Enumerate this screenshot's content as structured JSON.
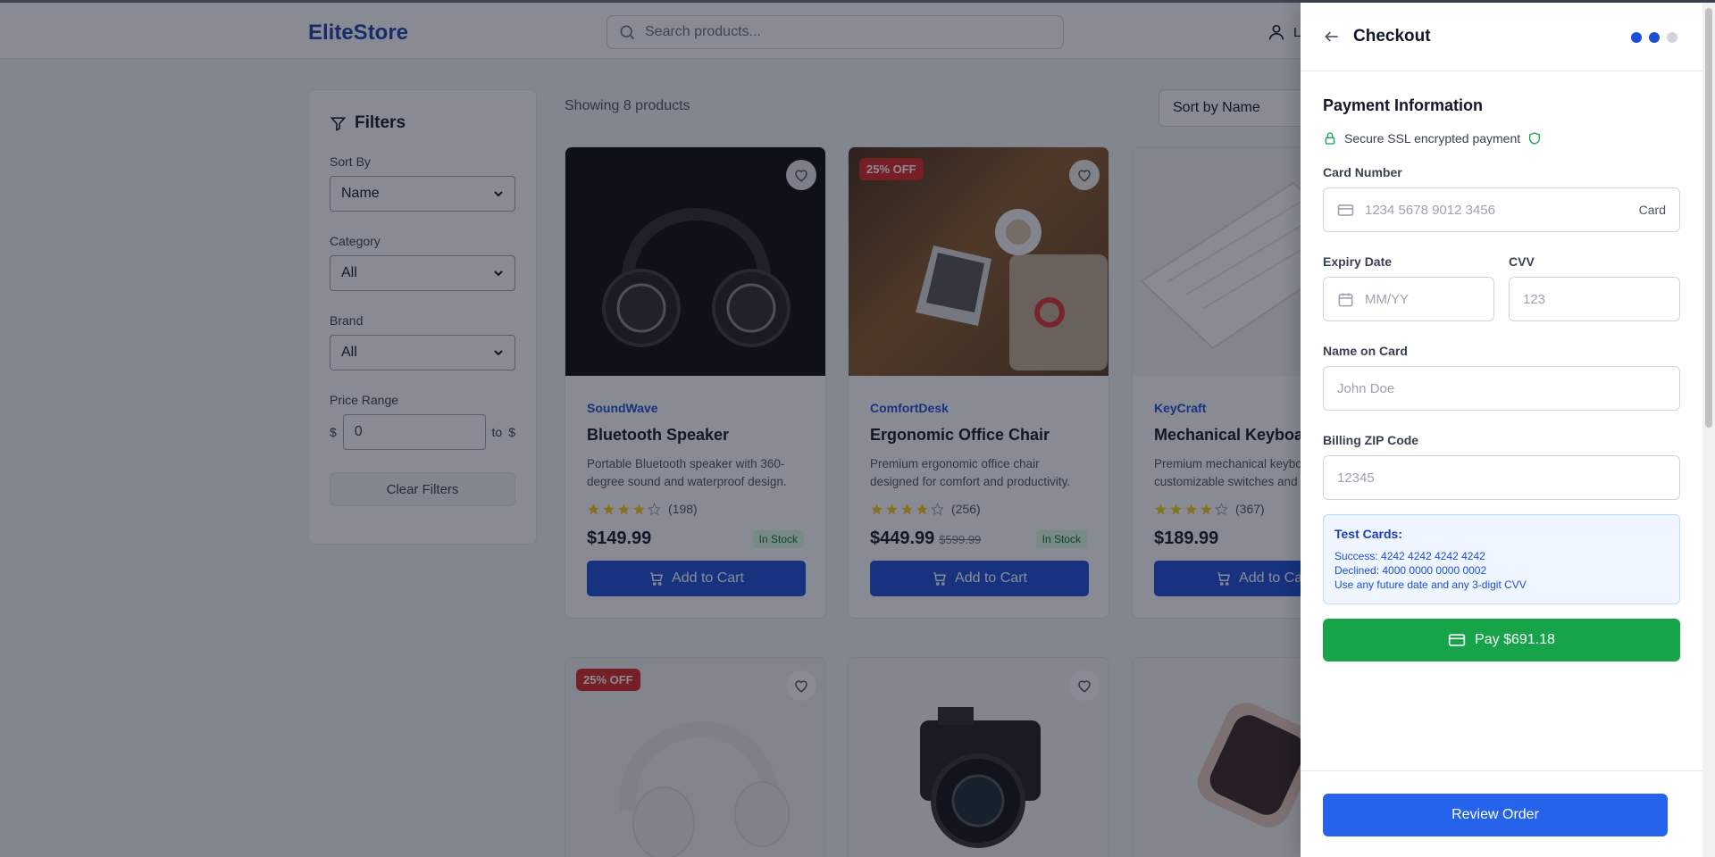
{
  "header": {
    "logo": "EliteStore",
    "search_placeholder": "Search products...",
    "user_label": "L"
  },
  "filters": {
    "title": "Filters",
    "sort_label": "Sort By",
    "sort_value": "Name",
    "category_label": "Category",
    "category_value": "All",
    "brand_label": "Brand",
    "brand_value": "All",
    "price_label": "Price Range",
    "currency": "$",
    "price_min": "0",
    "to_label": "to",
    "currency2": "$",
    "clear_label": "Clear Filters"
  },
  "main": {
    "showing": "Showing 8 products",
    "sort_select": "Sort by Name"
  },
  "products": [
    {
      "brand": "SoundWave",
      "name": "Bluetooth Speaker",
      "desc": "Portable Bluetooth speaker with 360-degree sound and waterproof design.",
      "rating": 4,
      "reviews": "(198)",
      "price": "$149.99",
      "old_price": "",
      "stock": "In Stock",
      "badge": "",
      "add_label": "Add to Cart"
    },
    {
      "brand": "ComfortDesk",
      "name": "Ergonomic Office Chair",
      "desc": "Premium ergonomic office chair designed for comfort and productivity.",
      "rating": 4,
      "reviews": "(256)",
      "price": "$449.99",
      "old_price": "$599.99",
      "stock": "In Stock",
      "badge": "25% OFF",
      "add_label": "Add to Cart"
    },
    {
      "brand": "KeyCraft",
      "name": "Mechanical Keyboard",
      "desc": "Premium mechanical keyboard with customizable switches and RGB.",
      "rating": 4,
      "reviews": "(367)",
      "price": "$189.99",
      "old_price": "",
      "stock": "",
      "badge": "",
      "add_label": "Add to Cart"
    },
    {
      "badge": "25% OFF"
    }
  ],
  "checkout": {
    "title": "Checkout",
    "section_title": "Payment Information",
    "secure_text": "Secure SSL encrypted payment",
    "card_number_label": "Card Number",
    "card_number_placeholder": "1234 5678 9012 3456",
    "card_tag": "Card",
    "expiry_label": "Expiry Date",
    "expiry_placeholder": "MM/YY",
    "cvv_label": "CVV",
    "cvv_placeholder": "123",
    "name_label": "Name on Card",
    "name_placeholder": "John Doe",
    "zip_label": "Billing ZIP Code",
    "zip_placeholder": "12345",
    "test_title": "Test Cards:",
    "test_success": "Success: 4242 4242 4242 4242",
    "test_declined": "Declined: 4000 0000 0000 0002",
    "test_note": "Use any future date and any 3-digit CVV",
    "pay_label": "Pay $691.18",
    "review_label": "Review Order",
    "current_step": 2,
    "total_steps": 3
  },
  "colors": {
    "brand": "#1d4ed8",
    "pay": "#16a34a",
    "review": "#2563eb",
    "badge": "#dc2626"
  }
}
